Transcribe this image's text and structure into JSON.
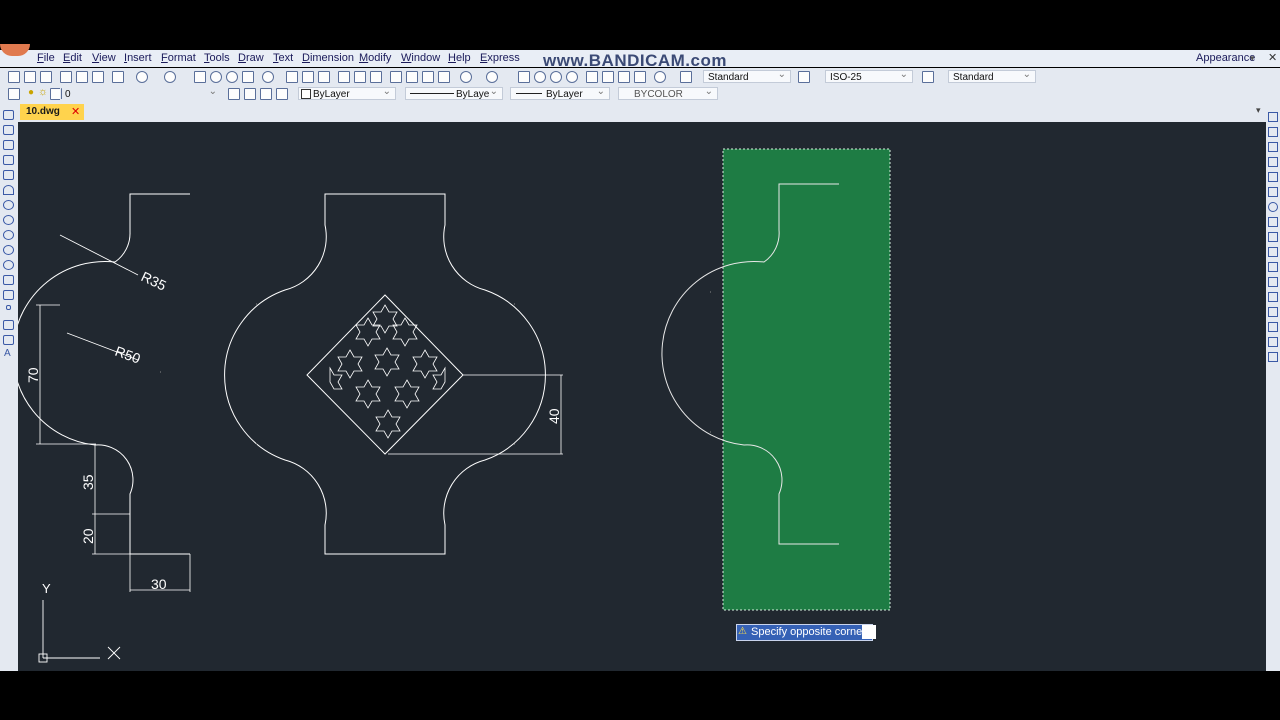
{
  "menu": [
    "File",
    "Edit",
    "View",
    "Insert",
    "Format",
    "Tools",
    "Draw",
    "Text",
    "Dimension",
    "Modify",
    "Window",
    "Help",
    "Express"
  ],
  "watermark": "www.BANDICAM.com",
  "appearance": "Appearance",
  "styles": {
    "text_style": "Standard",
    "dim_style": "ISO-25",
    "table_style": "Standard"
  },
  "layer": {
    "current": "0",
    "color": "ByLayer",
    "linetype": "ByLaye",
    "lineweight": "ByLayer",
    "plotstyle": "BYCOLOR"
  },
  "tab": {
    "label": "10.dwg",
    "close": "✕"
  },
  "drawing": {
    "dim_r35": "R35",
    "dim_r50": "R50",
    "dim_70": "70",
    "dim_35": "35",
    "dim_20": "20",
    "dim_30": "30",
    "dim_40": "40",
    "ucs_y": "Y",
    "ucs_x": "X"
  },
  "prompt": {
    "text": "Specify opposite corner:"
  },
  "colors": {
    "canvas": "#212830",
    "selection_fill": "#1e7c44",
    "prompt_bg": "#3561b5",
    "tab_active": "#ffd34d"
  }
}
